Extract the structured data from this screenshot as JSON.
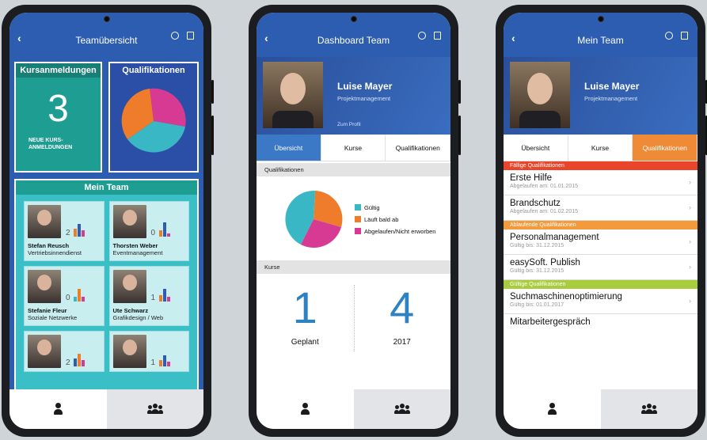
{
  "phone1": {
    "header": {
      "back": "‹",
      "title": "Teamübersicht"
    },
    "tile_course": {
      "title": "Kursanmeldungen",
      "count": "3",
      "sub1": "NEUE KURS-",
      "sub2": "ANMELDUNGEN"
    },
    "tile_qual": {
      "title": "Qualifikationen"
    },
    "team": {
      "title": "Mein Team",
      "members": [
        {
          "name": "Stefan Reusch",
          "role": "Vertriebsinnendienst",
          "count": "2"
        },
        {
          "name": "Thorsten Weber",
          "role": "Eventmanagement",
          "count": "0"
        },
        {
          "name": "Stefanie Fleur",
          "role": "Soziale Netzwerke",
          "count": "0"
        },
        {
          "name": "Ute Schwarz",
          "role": "Grafikdesign / Web",
          "count": "1"
        },
        {
          "name": "",
          "role": "",
          "count": "2"
        },
        {
          "name": "",
          "role": "",
          "count": "1"
        }
      ]
    }
  },
  "phone2": {
    "header": {
      "back": "‹",
      "title": "Dashboard Team"
    },
    "profile": {
      "name": "Luise Mayer",
      "role": "Projektmanagement",
      "link": "Zum Profil"
    },
    "tabs": [
      "Übersicht",
      "Kurse",
      "Qualifikationen"
    ],
    "sec_qual": "Qualifikationen",
    "legend": [
      "Gültig",
      "Läuft bald ab",
      "Abgelaufen/Nicht erworben"
    ],
    "sec_kurse": "Kurse",
    "kurse": [
      {
        "value": "1",
        "label": "Geplant"
      },
      {
        "value": "4",
        "label": "2017"
      }
    ]
  },
  "phone3": {
    "header": {
      "back": "‹",
      "title": "Mein Team"
    },
    "profile": {
      "name": "Luise Mayer",
      "role": "Projektmanagement"
    },
    "tabs": [
      "Übersicht",
      "Kurse",
      "Qualifikationen"
    ],
    "sections": [
      {
        "title": "Fällige Qualifikationen",
        "color": "#e8452a",
        "items": [
          {
            "name": "Erste Hilfe",
            "date": "Abgelaufen am: 01.01.2015"
          },
          {
            "name": "Brandschutz",
            "date": "Abgelaufen am: 01.02.2015"
          }
        ]
      },
      {
        "title": "Ablaufende Qualifikationen",
        "color": "#f39a3c",
        "items": [
          {
            "name": "Personalmanagement",
            "date": "Gültig bis: 31.12.2015"
          },
          {
            "name": "easySoft. Publish",
            "date": "Gültig bis: 31.12.2015"
          }
        ]
      },
      {
        "title": "Gültige Qualifikationen",
        "color": "#a9cc3f",
        "items": [
          {
            "name": "Suchmaschinenoptimierung",
            "date": "Gültig bis: 01.01.2017"
          },
          {
            "name": "Mitarbeitergespräch",
            "date": ""
          }
        ]
      }
    ]
  },
  "colors": {
    "header_blue": "#2d5db0",
    "teal": "#1e9d92",
    "pie_valid": "#3ab7c4",
    "pie_expiring": "#ee7c2a",
    "pie_expired": "#d63a93"
  },
  "icons": [
    "back-icon",
    "refresh-icon",
    "logout-icon",
    "person-icon",
    "group-icon",
    "chevron-right-icon"
  ]
}
